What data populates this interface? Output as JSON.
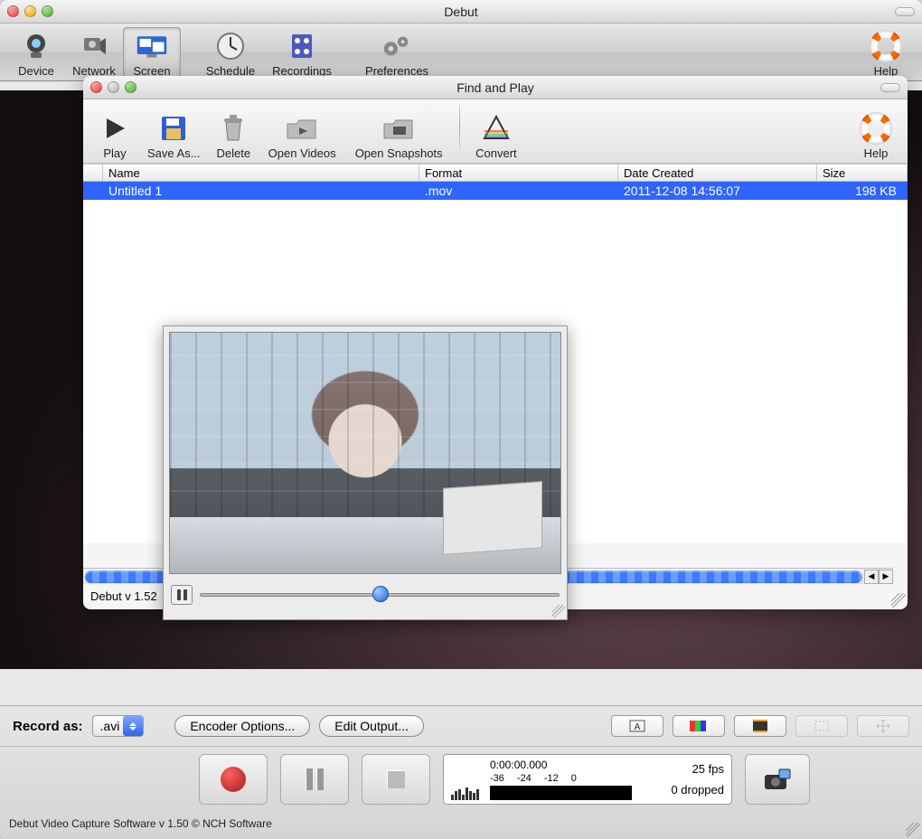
{
  "main": {
    "title": "Debut",
    "toolbar": {
      "device": "Device",
      "network": "Network",
      "screen": "Screen",
      "schedule": "Schedule",
      "recordings": "Recordings",
      "preferences": "Preferences",
      "help": "Help"
    }
  },
  "recordbar": {
    "label": "Record as:",
    "format": ".avi",
    "encoder": "Encoder Options...",
    "output": "Edit Output..."
  },
  "meter": {
    "time": "0:00:00.000",
    "scale": [
      "-36",
      "-24",
      "-12",
      "0"
    ],
    "fps": "25 fps",
    "dropped": "0 dropped"
  },
  "footer": "Debut Video Capture Software v 1.50 © NCH Software",
  "fp": {
    "title": "Find and Play",
    "toolbar": {
      "play": "Play",
      "save": "Save As...",
      "delete": "Delete",
      "openvideos": "Open Videos",
      "opensnapshots": "Open Snapshots",
      "convert": "Convert",
      "help": "Help"
    },
    "columns": {
      "name": "Name",
      "format": "Format",
      "date": "Date Created",
      "size": "Size"
    },
    "rows": [
      {
        "name": "Untitled 1",
        "format": ".mov",
        "date": "2011-12-08 14:56:07",
        "size": "198 KB"
      }
    ],
    "footer": "Debut v 1.52"
  }
}
